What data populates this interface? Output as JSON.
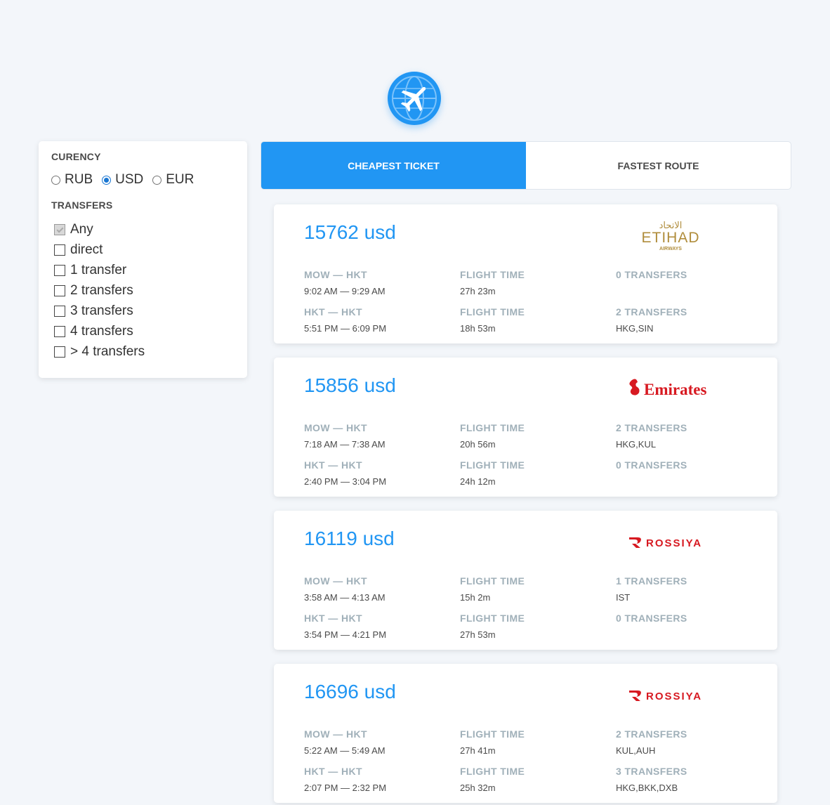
{
  "app": {
    "logo_icon": "airplane-globe-icon",
    "accent": "#2196f3"
  },
  "filters": {
    "currency_title": "CURENCY",
    "currencies": [
      {
        "label": "RUB",
        "checked": false
      },
      {
        "label": "USD",
        "checked": true
      },
      {
        "label": "EUR",
        "checked": false
      }
    ],
    "transfers_title": "TRANSFERS",
    "transfers": [
      {
        "label": "Any",
        "checked": true
      },
      {
        "label": "direct",
        "checked": false
      },
      {
        "label": "1 transfer",
        "checked": false
      },
      {
        "label": "2 transfers",
        "checked": false
      },
      {
        "label": "3 transfers",
        "checked": false
      },
      {
        "label": "4 transfers",
        "checked": false
      },
      {
        "label": "> 4 transfers",
        "checked": false
      }
    ]
  },
  "tabs": {
    "cheapest": "CHEAPEST TICKET",
    "fastest": "FASTEST ROUTE",
    "active": "cheapest"
  },
  "tickets": [
    {
      "price": "15762 usd",
      "carrier": "etihad",
      "carrier_logo": {
        "arabic": "الاتحاد",
        "main": "ETIHAD",
        "sub": "AIRWAYS"
      },
      "segments": [
        {
          "route": "MOW — HKT",
          "times": "9:02 AM — 9:29 AM",
          "duration_label": "FLIGHT TIME",
          "duration": "27h 23m",
          "stops_label": "0 TRANSFERS",
          "stops": ""
        },
        {
          "route": "HKT — HKT",
          "times": "5:51 PM — 6:09 PM",
          "duration_label": "FLIGHT TIME",
          "duration": "18h 53m",
          "stops_label": "2 TRANSFERS",
          "stops": "HKG,SIN"
        }
      ]
    },
    {
      "price": "15856 usd",
      "carrier": "emirates",
      "carrier_logo": {
        "main": "Emirates"
      },
      "segments": [
        {
          "route": "MOW — HKT",
          "times": "7:18 AM — 7:38 AM",
          "duration_label": "FLIGHT TIME",
          "duration": "20h 56m",
          "stops_label": "2 TRANSFERS",
          "stops": "HKG,KUL"
        },
        {
          "route": "HKT — HKT",
          "times": "2:40 PM — 3:04 PM",
          "duration_label": "FLIGHT TIME",
          "duration": "24h 12m",
          "stops_label": "0 TRANSFERS",
          "stops": ""
        }
      ]
    },
    {
      "price": "16119 usd",
      "carrier": "rossiya",
      "carrier_logo": {
        "main": "ROSSIYA"
      },
      "segments": [
        {
          "route": "MOW — HKT",
          "times": "3:58 AM — 4:13 AM",
          "duration_label": "FLIGHT TIME",
          "duration": "15h 2m",
          "stops_label": "1 TRANSFERS",
          "stops": "IST"
        },
        {
          "route": "HKT — HKT",
          "times": "3:54 PM — 4:21 PM",
          "duration_label": "FLIGHT TIME",
          "duration": "27h 53m",
          "stops_label": "0 TRANSFERS",
          "stops": ""
        }
      ]
    },
    {
      "price": "16696 usd",
      "carrier": "rossiya",
      "carrier_logo": {
        "main": "ROSSIYA"
      },
      "segments": [
        {
          "route": "MOW — HKT",
          "times": "5:22 AM — 5:49 AM",
          "duration_label": "FLIGHT TIME",
          "duration": "27h 41m",
          "stops_label": "2 TRANSFERS",
          "stops": "KUL,AUH"
        },
        {
          "route": "HKT — HKT",
          "times": "2:07 PM — 2:32 PM",
          "duration_label": "FLIGHT TIME",
          "duration": "25h 32m",
          "stops_label": "3 TRANSFERS",
          "stops": "HKG,BKK,DXB"
        }
      ]
    }
  ]
}
